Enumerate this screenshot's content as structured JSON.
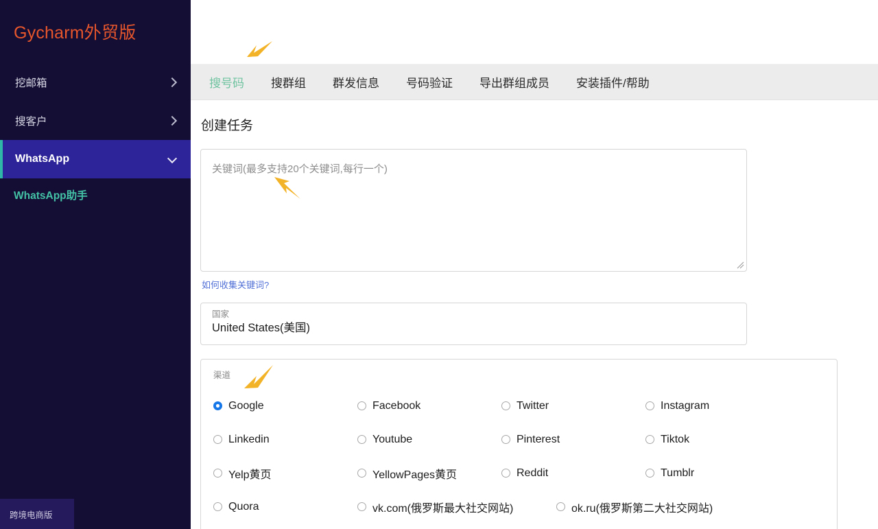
{
  "sidebar": {
    "brand": "Gycharm外贸版",
    "items": [
      {
        "label": "挖邮箱",
        "icon": "chevron-right-icon"
      },
      {
        "label": "搜客户",
        "icon": "chevron-right-icon"
      },
      {
        "label": "WhatsApp",
        "icon": "chevron-down-icon",
        "active": true
      }
    ],
    "sub_item": "WhatsApp助手",
    "badge": "跨境电商版"
  },
  "tabs": [
    {
      "label": "搜号码",
      "active": true
    },
    {
      "label": "搜群组",
      "active": false
    },
    {
      "label": "群发信息",
      "active": false
    },
    {
      "label": "号码验证",
      "active": false
    },
    {
      "label": "导出群组成员",
      "active": false
    },
    {
      "label": "安装插件/帮助",
      "active": false
    }
  ],
  "form": {
    "title": "创建任务",
    "keyword_placeholder": "关键词(最多支持20个关键词,每行一个)",
    "keyword_value": "",
    "keyword_help_link": "如何收集关键词?",
    "country_label": "国家",
    "country_value": "United States(美国)",
    "channel_label": "渠道",
    "channels": [
      {
        "label": "Google",
        "checked": true
      },
      {
        "label": "Facebook",
        "checked": false
      },
      {
        "label": "Twitter",
        "checked": false
      },
      {
        "label": "Instagram",
        "checked": false
      },
      {
        "label": "Linkedin",
        "checked": false
      },
      {
        "label": "Youtube",
        "checked": false
      },
      {
        "label": "Pinterest",
        "checked": false
      },
      {
        "label": "Tiktok",
        "checked": false
      },
      {
        "label": "Yelp黄页",
        "checked": false
      },
      {
        "label": "YellowPages黄页",
        "checked": false
      },
      {
        "label": "Reddit",
        "checked": false
      },
      {
        "label": "Tumblr",
        "checked": false
      },
      {
        "label": "Quora",
        "checked": false
      },
      {
        "label": "vk.com(俄罗斯最大社交网站)",
        "checked": false
      },
      {
        "label": "ok.ru(俄罗斯第二大社交网站)",
        "checked": false
      }
    ]
  },
  "annotations": {
    "arrow_color": "#f3b328",
    "arrows": [
      {
        "name": "arrow-to-tab-bar",
        "direction": "down-left"
      },
      {
        "name": "arrow-to-keyword-field",
        "direction": "up-left"
      },
      {
        "name": "arrow-to-channel-label",
        "direction": "down-left"
      }
    ]
  },
  "colors": {
    "sidebar_bg": "#140e35",
    "sidebar_active_bg": "#2e2499",
    "sidebar_accent": "#2fb6a8",
    "brand": "#e8562c",
    "tab_active": "#6fc3a0",
    "tabbar_bg": "#ececec",
    "link": "#5170d6",
    "radio_checked": "#1677e8"
  }
}
